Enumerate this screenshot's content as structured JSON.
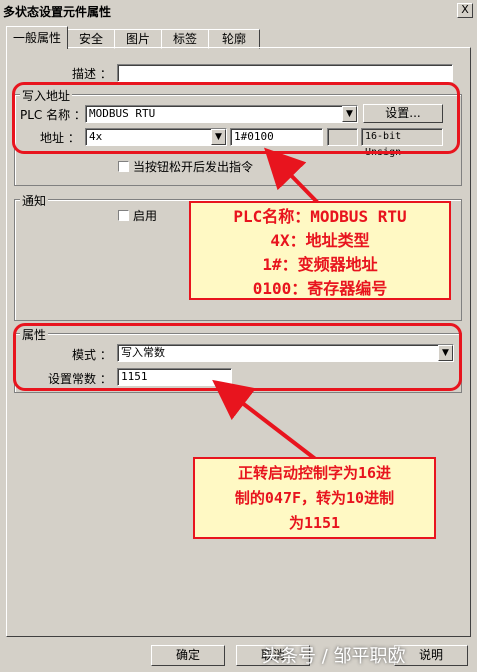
{
  "window": {
    "title": "多状态设置元件属性",
    "close_label": "X"
  },
  "tabs": [
    {
      "label": "一般属性",
      "active": true
    },
    {
      "label": "安全"
    },
    {
      "label": "图片"
    },
    {
      "label": "标签"
    },
    {
      "label": "轮廓"
    }
  ],
  "general": {
    "description_label": "描述 ：",
    "description_value": ""
  },
  "write_address": {
    "legend": "写入地址",
    "plc_label": "PLC 名称 ：",
    "plc_value": "MODBUS RTU",
    "settings_button": "设置...",
    "address_label": "地址 ：",
    "address_type": "4x",
    "address_value": "1#0100",
    "data_format": "16-bit Unsign",
    "release_checkbox_label": "当按钮松开后发出指令"
  },
  "notify": {
    "legend": "通知",
    "enable_label": "启用"
  },
  "attributes": {
    "legend": "属性",
    "mode_label": "模式 ：",
    "mode_value": "写入常数",
    "constant_label": "设置常数 ：",
    "constant_value": "1151"
  },
  "annotations": {
    "plc_note": [
      "PLC名称：MODBUS RTU",
      "4X：地址类型",
      "1#：变频器地址",
      "0100：寄存器编号"
    ],
    "control_note": [
      "正转启动控制字为16进",
      "制的047F，转为10进制",
      "为1151"
    ]
  },
  "footer": {
    "ok_button": "确定",
    "cancel_button": "取消",
    "help_button": "说明"
  },
  "watermark": "头条号 / 邹平职欧",
  "colors": {
    "annotation_red": "#e8141e",
    "annotation_fill": "#fff9c4",
    "dialog_gray": "#d4d0c8"
  }
}
